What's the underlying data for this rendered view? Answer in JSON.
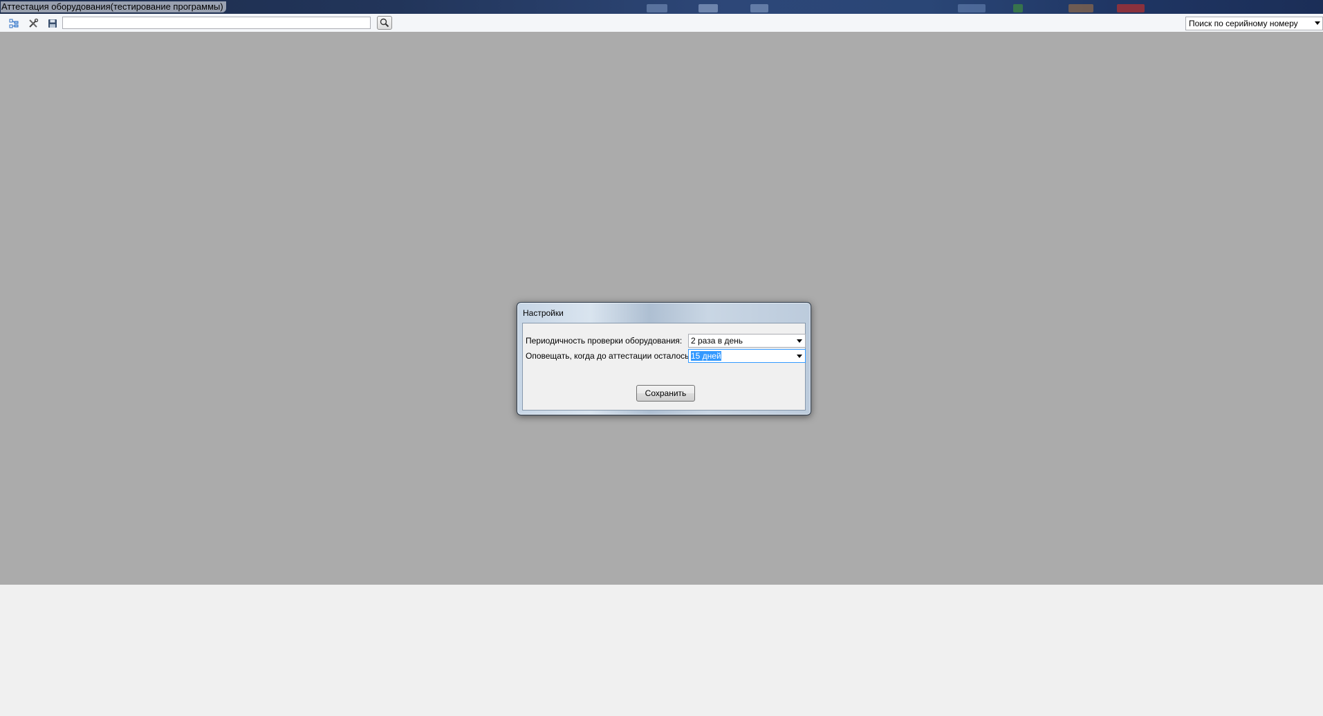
{
  "window": {
    "title": "Аттестация оборудования(тестирование программы)"
  },
  "toolbar": {
    "icons": [
      "tree-view-icon",
      "tools-icon",
      "save-icon"
    ],
    "search_value": "",
    "search_icon": "magnifier-icon",
    "search_mode": "Поиск по серийному номеру"
  },
  "dialog": {
    "title": "Настройки",
    "check_period_label": "Периодичность проверки оборудования:",
    "check_period_value": "2 раза в день",
    "notify_label": "Оповещать, когда до аттестации осталось:",
    "notify_value": "15 дней",
    "save_label": "Сохранить"
  },
  "colors": {
    "mdi_background": "#ababab",
    "selection": "#3399ff"
  }
}
